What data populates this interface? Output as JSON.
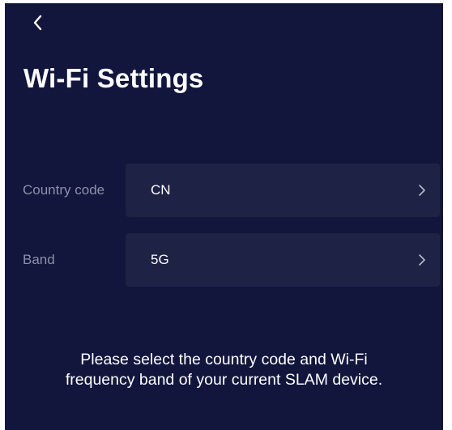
{
  "nav": {
    "back_icon": "chevron-left-icon"
  },
  "page": {
    "title": "Wi-Fi Settings"
  },
  "settings": [
    {
      "label": "Country code",
      "value": "CN",
      "icon": "chevron-right-icon"
    },
    {
      "label": "Band",
      "value": "5G",
      "icon": "chevron-right-icon"
    }
  ],
  "info": {
    "line1": "Please select the country code and Wi-Fi",
    "line2": "frequency band of your current SLAM device."
  },
  "colors": {
    "background": "#12163d",
    "field_background": "#1e2244",
    "label_text": "#8c90a8",
    "primary_text": "#ffffff"
  }
}
